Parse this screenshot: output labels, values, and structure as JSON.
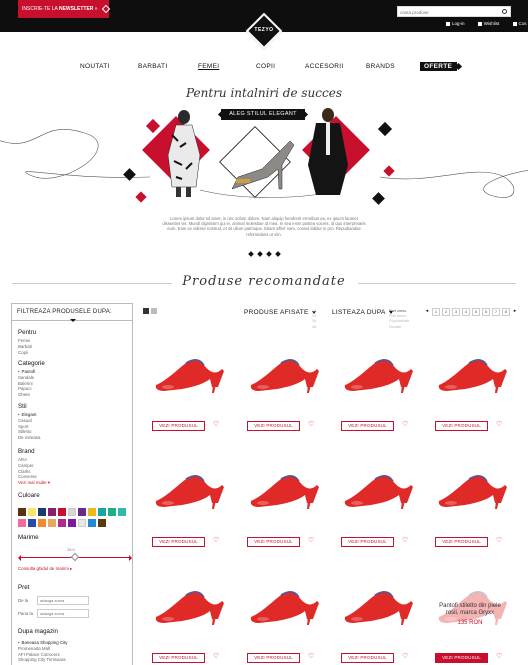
{
  "header": {
    "newsletter_prefix": "INSCRIE-TE LA ",
    "newsletter_bold": "NEWSLETTER",
    "newsletter_arrow": "»",
    "search_placeholder": "cauta produse",
    "user_links": [
      "Log-in",
      "Wishlist",
      "Cos"
    ],
    "logo_text": "TEZYO"
  },
  "nav": {
    "items": [
      "NOUTATI",
      "BARBATI",
      "FEMEI",
      "COPII",
      "ACCESORII",
      "BRANDS",
      "OFERTE"
    ],
    "active": "FEMEI"
  },
  "hero": {
    "title": "Pentru intalniri de succes",
    "button": "ALEG STILUL ELEGANT",
    "copy": "Lorem ipsum dolor sit amet, in nec solum dolore. Nam aliquip hendrerit erroribus ea, ex ipsum laoreet dissentiet vis. Mundi dignissim qui ei, animal molestiae id mea. In sea enim postea vocent, id quo interpretaris eum. Eam ex vidisse nostrud, et sit ullum patrioque. Etiam affert nam, consul labitur in pro. Repudiandae reformidans ut vim.",
    "slides": 4,
    "accent": "#c8102e"
  },
  "section_title": "Produse recomandate",
  "sidebar": {
    "heading": "FILTREAZA PRODUSELE DUPA:",
    "pentru": {
      "title": "Pentru",
      "items": [
        "Femei",
        "Barbati",
        "Copii"
      ]
    },
    "categorie": {
      "title": "Categorie",
      "items": [
        "Pantofi",
        "Sandale",
        "Balerini",
        "Papuci",
        "Ghete"
      ],
      "selected": "Pantofi"
    },
    "stil": {
      "title": "Stil",
      "items": [
        "Elegant",
        "Casual",
        "Sport",
        "Stiletto",
        "De mireasa"
      ],
      "selected": "Elegant"
    },
    "brand": {
      "title": "Brand",
      "items": [
        "ARA",
        "Camper",
        "Clarks",
        "Converse"
      ],
      "more": "Vezi mai multe"
    },
    "culoare": {
      "title": "Culoare",
      "colors": [
        "#5a3210",
        "#f3e66a",
        "#1b3a6e",
        "#8b1d6e",
        "#c8102e",
        "#d6d6d6",
        "#6a2a8a",
        "#f0b81a",
        "#1aa6a0",
        "#1fae8a",
        "#2fb8b0",
        "#f06a9a",
        "#2a4aa8",
        "#f08a2a",
        "#e9a860",
        "#b02a8a",
        "#7a1aa0",
        "#e8e8e8",
        "#1f8ad0",
        "#5a3a10"
      ]
    },
    "marime": {
      "title": "Marime",
      "value": "38.5",
      "guide": "Consulta ghidul de marimi"
    },
    "pret": {
      "title": "Pret",
      "from_label": "De la",
      "to_label": "Pana la",
      "placeholder": "adauga suma"
    },
    "magazin": {
      "title": "Dupa magazin",
      "items": [
        "Baneasa Shopping City",
        "Promenada Mall",
        "AFI Palace Cotroceni",
        "Shopping City Timisoara"
      ],
      "selected": "Baneasa Shopping City"
    }
  },
  "toolbar": {
    "produse_afisate": "PRODUSE AFISATE",
    "produse_options": [
      "12",
      "24",
      "36",
      "48"
    ],
    "listeaza_dupa": "LISTEAZA DUPA",
    "listeaza_options": [
      "Pret cresc.",
      "Pret descr.",
      "Popularitate",
      "Noutati"
    ],
    "pages": [
      "1",
      "2",
      "3",
      "4",
      "5",
      "6",
      "7",
      "8"
    ]
  },
  "products": {
    "button_label": "VEZI PRODUSUL",
    "heart": "♡",
    "hover_name": "Pantofi stiletto din piele rosii, marca Gryxx",
    "hover_price": "135 RON",
    "shoe_color": "#e02a28"
  }
}
